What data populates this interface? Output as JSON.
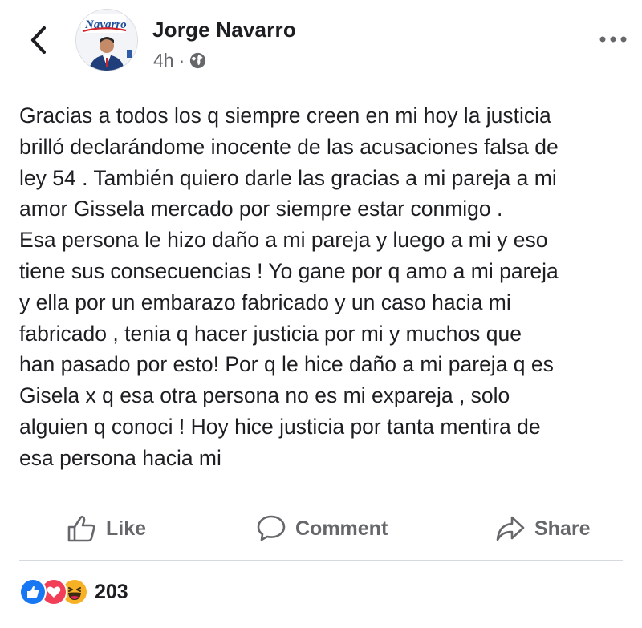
{
  "post": {
    "author": "Jorge Navarro",
    "time": "4h",
    "separator": "·",
    "privacy_icon": "globe-icon",
    "avatar_brand": "Navarro",
    "text": "Gracias a todos los q siempre creen en mi hoy la justicia\nbrilló declarándome inocente de las acusaciones falsa de\nley 54 . También quiero darle las gracias a mi pareja a mi\namor Gissela mercado por siempre estar conmigo .\nEsa persona le hizo daño a mi pareja y luego a mi y eso\ntiene sus consecuencias ! Yo gane por q amo a mi pareja\ny ella por un embarazo fabricado y  un caso hacia mi\nfabricado , tenia q hacer justicia por mi y muchos que\nhan pasado por esto! Por q le hice daño a mi pareja q es\nGisela x q esa otra persona no es mi expareja , solo\nalguien q conoci ! Hoy hice justicia por tanta mentira de\nesa persona hacia mi"
  },
  "actions": {
    "like": "Like",
    "comment": "Comment",
    "share": "Share"
  },
  "reactions": {
    "icons": [
      "like-icon",
      "love-icon",
      "haha-icon"
    ],
    "count": "203"
  },
  "colors": {
    "text": "#1c1e21",
    "secondary": "#65676b",
    "like_blue": "#1877f2",
    "love_red": "#f33e58",
    "haha_yellow": "#f7b125"
  }
}
